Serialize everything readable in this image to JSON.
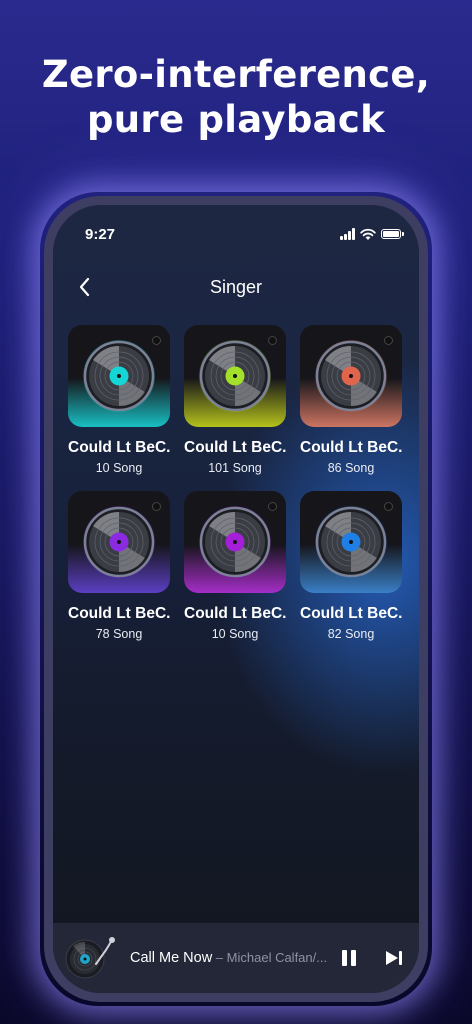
{
  "headline": {
    "line1": "Zero-interference,",
    "line2": "pure playback"
  },
  "status_bar": {
    "time": "9:27"
  },
  "header": {
    "title": "Singer"
  },
  "singers": [
    {
      "name": "Could Lt BeC...",
      "count": "10 Song",
      "accent": "#15d5d5",
      "base": "#19c0c4"
    },
    {
      "name": "Could Lt BeC...",
      "count": "101 Song",
      "accent": "#a2e02a",
      "base": "#b5c21b"
    },
    {
      "name": "Could Lt BeC...",
      "count": "86 Song",
      "accent": "#e0654c",
      "base": "#cd7562"
    },
    {
      "name": "Could Lt BeC...",
      "count": "78 Song",
      "accent": "#8a2be2",
      "base": "#5b3fc2"
    },
    {
      "name": "Could Lt BeC...",
      "count": "10 Song",
      "accent": "#a51fd8",
      "base": "#a52ec7"
    },
    {
      "name": "Could Lt BeC...",
      "count": "82 Song",
      "accent": "#1f7fe5",
      "base": "#3a7fc6"
    }
  ],
  "now_playing": {
    "title": "Call Me Now",
    "separator": " – ",
    "artist": "Michael Calfan/...",
    "icons": {
      "pause": "pause-icon",
      "next": "skip-next-icon"
    }
  }
}
